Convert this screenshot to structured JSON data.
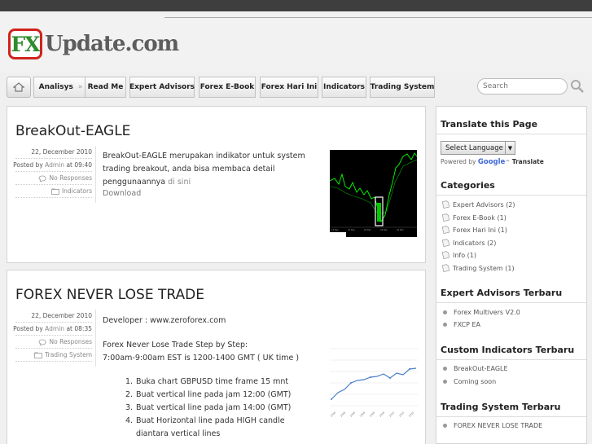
{
  "logo": {
    "fx": "FX",
    "text": "Update.com"
  },
  "nav": {
    "items": [
      {
        "label": "Analisys",
        "chevron": "»"
      },
      {
        "label": "Read Me"
      },
      {
        "label": "Expert Advisors"
      },
      {
        "label": "Forex E-Book"
      },
      {
        "label": "Forex Hari Ini"
      },
      {
        "label": "Indicators"
      },
      {
        "label": "Trading System"
      }
    ],
    "home_icon": "home-icon",
    "search_placeholder": "Search",
    "search_icon": "magnifier-icon"
  },
  "posts": [
    {
      "title": "BreakOut-EAGLE",
      "date": "22, December 2010",
      "posted_prefix": "Posted by",
      "author": "Admin",
      "at": "at 09:40",
      "comments": "No Responses",
      "category": "Indicators",
      "text_before_link": "BreakOut-EAGLE merupakan indikator untuk system trading breakout, anda bisa membaca detail penggunaannya",
      "link": "di sini",
      "download": "Download"
    },
    {
      "title": "FOREX NEVER LOSE TRADE",
      "date": "22, December 2010",
      "posted_prefix": "Posted by",
      "author": "Admin",
      "at": "at 08:35",
      "comments": "No Responses",
      "category": "Trading System",
      "developer": "Developer : www.zeroforex.com",
      "step_title": "Forex Never Lose Trade Step by Step:",
      "time_line": "7:00am-9:00am EST is 1200-1400 GMT ( UK time )",
      "steps": [
        "Buka chart GBPUSD time frame 15 mnt",
        "Buat vertical line pada jam 12:00 (GMT)",
        "Buat vertical line pada jam 14:00 (GMT)",
        "Buat Horizontal line pada HIGH candle diantara vertical lines"
      ]
    }
  ],
  "sidebar": {
    "translate": {
      "title": "Translate this Page",
      "button": "Select Language",
      "powered_by": "Powered by",
      "google": "Google",
      "tm": "™",
      "translate_word": "Translate"
    },
    "categories": {
      "title": "Categories",
      "items": [
        {
          "label": "Expert Advisors (2)"
        },
        {
          "label": "Forex E-Book (1)"
        },
        {
          "label": "Forex Hari Ini (1)"
        },
        {
          "label": "Indicators (2)"
        },
        {
          "label": "Info (1)"
        },
        {
          "label": "Trading System (1)"
        }
      ]
    },
    "ea_latest": {
      "title": "Expert Advisors Terbaru",
      "items": [
        "Forex Multivers V2.0",
        "FXCP EA"
      ]
    },
    "ind_latest": {
      "title": "Custom Indicators Terbaru",
      "items": [
        "BreakOut-EAGLE",
        "Coming soon"
      ]
    },
    "ts_latest": {
      "title": "Trading System Terbaru",
      "items": [
        "FOREX NEVER LOSE TRADE"
      ]
    }
  },
  "colors": {
    "logo_red": "#d0231c",
    "logo_green": "#2e8b2e",
    "chart_line": "#4a7fc8",
    "chart_bg": "#000000",
    "chart_green": "#00ff00"
  }
}
